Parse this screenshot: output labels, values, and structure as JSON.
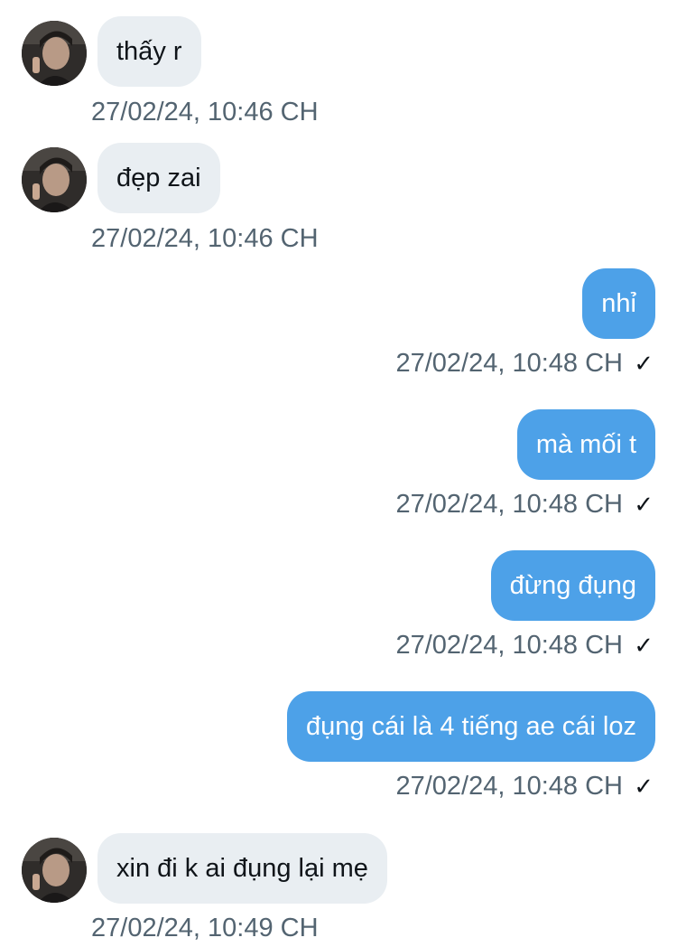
{
  "messages": [
    {
      "direction": "in",
      "text": "thấy r",
      "time": "27/02/24, 10:46 CH"
    },
    {
      "direction": "in",
      "text": "đẹp zai",
      "time": "27/02/24, 10:46 CH"
    },
    {
      "direction": "out",
      "text": "nhỉ",
      "time": "27/02/24, 10:48 CH",
      "status_icon": "checkmark-icon"
    },
    {
      "direction": "out",
      "text": "mà mối t",
      "time": "27/02/24, 10:48 CH",
      "status_icon": "checkmark-icon"
    },
    {
      "direction": "out",
      "text": "đừng đụng",
      "time": "27/02/24, 10:48 CH",
      "status_icon": "checkmark-icon"
    },
    {
      "direction": "out",
      "text": "đụng cái là 4 tiếng ae cái loz",
      "time": "27/02/24, 10:48 CH",
      "status_icon": "checkmark-icon"
    },
    {
      "direction": "in",
      "text": "xin đi k ai đụng lại mẹ",
      "time": "27/02/24, 10:49 CH"
    }
  ],
  "check_glyph": "✓",
  "colors": {
    "incoming_bubble": "#e9eef2",
    "outgoing_bubble": "#4da1e8",
    "timestamp": "#536471"
  }
}
